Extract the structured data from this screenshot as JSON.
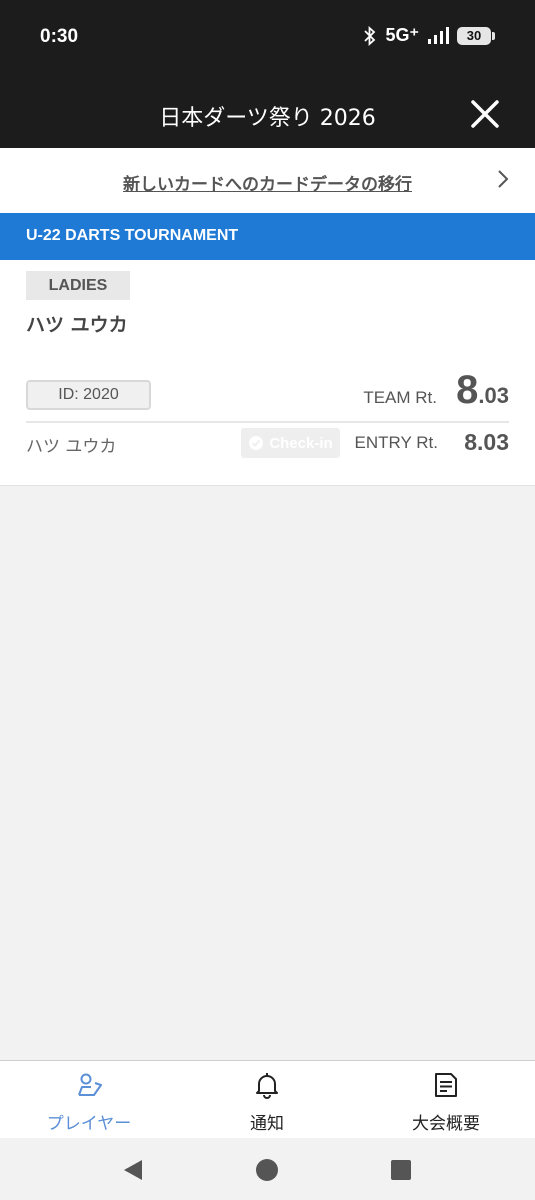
{
  "status_bar": {
    "time": "0:30",
    "network": "5G⁺",
    "battery": "30"
  },
  "header": {
    "title": "日本ダーツ祭り 2026"
  },
  "migration": {
    "link_text": "新しいカードへのカードデータの移行"
  },
  "tournament": {
    "name": "U-22 DARTS TOURNAMENT"
  },
  "player_card": {
    "category": "LADIES",
    "team_name": "ハツ ユウカ",
    "id_label": "ID: 2020",
    "team_rt_label": "TEAM Rt.",
    "team_rt_int": "8",
    "team_rt_dec": ".03",
    "member": {
      "name": "ハツ ユウカ",
      "checkin_label": "Check-in",
      "entry_rt_label": "ENTRY Rt.",
      "entry_rt_value": "8.03"
    }
  },
  "bottom_nav": {
    "items": [
      {
        "label": "プレイヤー",
        "icon": "player-icon",
        "active": true
      },
      {
        "label": "通知",
        "icon": "bell-icon",
        "active": false
      },
      {
        "label": "大会概要",
        "icon": "document-icon",
        "active": false
      }
    ]
  },
  "colors": {
    "accent": "#1f7ad6",
    "active_nav": "#5b8fd6",
    "header_bg": "#1c1c1c"
  }
}
